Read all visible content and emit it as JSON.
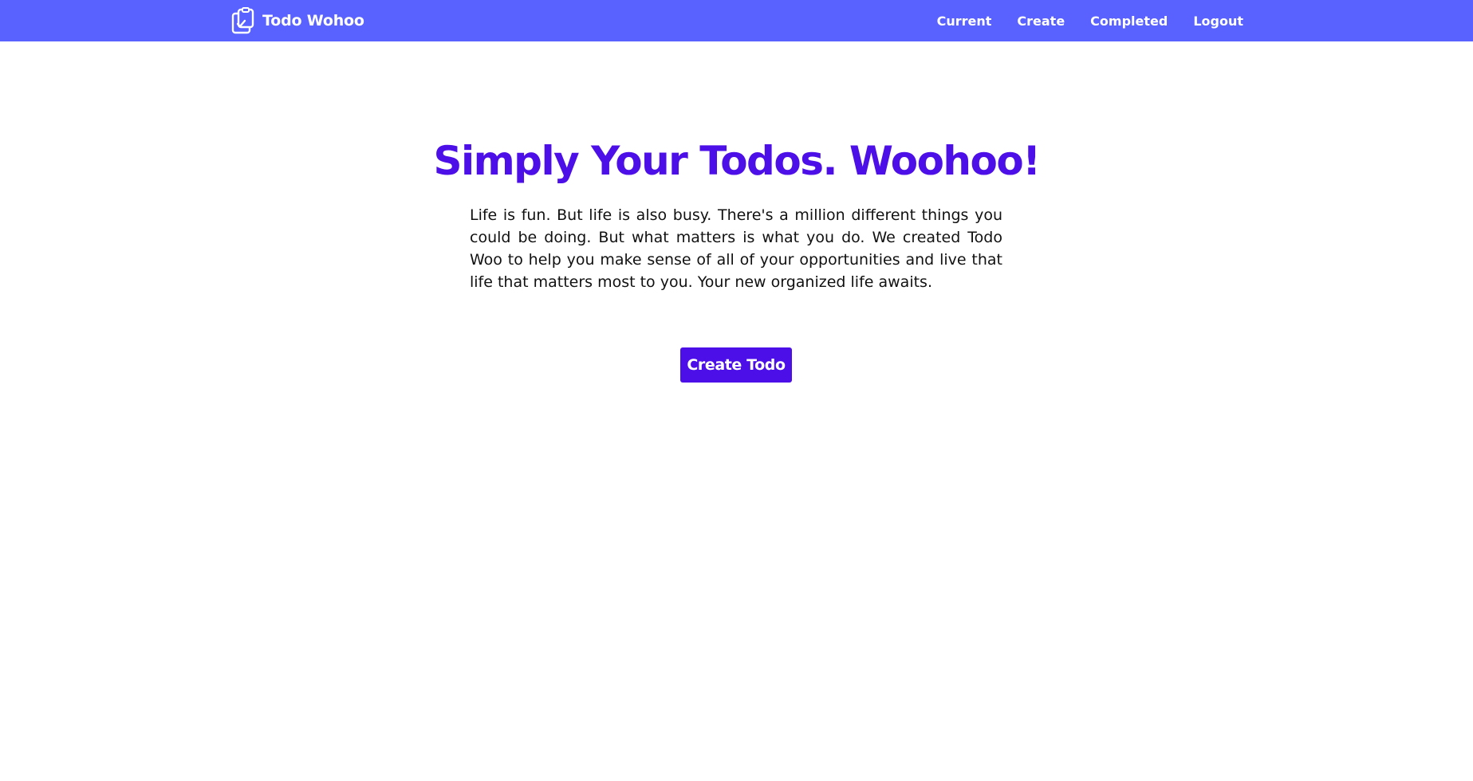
{
  "navbar": {
    "brand_name": "Todo Wohoo",
    "brand_icon": "clipboard-check-icon",
    "links": [
      {
        "label": "Current"
      },
      {
        "label": "Create"
      },
      {
        "label": "Completed"
      },
      {
        "label": "Logout"
      }
    ],
    "background_color": "#5961ff"
  },
  "hero": {
    "title": "Simply Your Todos. Woohoo!",
    "description": "Life is fun. But life is also busy. There's a million different things you could be doing. But what matters is what you do. We created Todo Woo to help you make sense of all of your opportunities and live that life that matters most to you. Your new organized life awaits.",
    "cta_label": "Create Todo",
    "accent_color": "#4d0fe8"
  }
}
